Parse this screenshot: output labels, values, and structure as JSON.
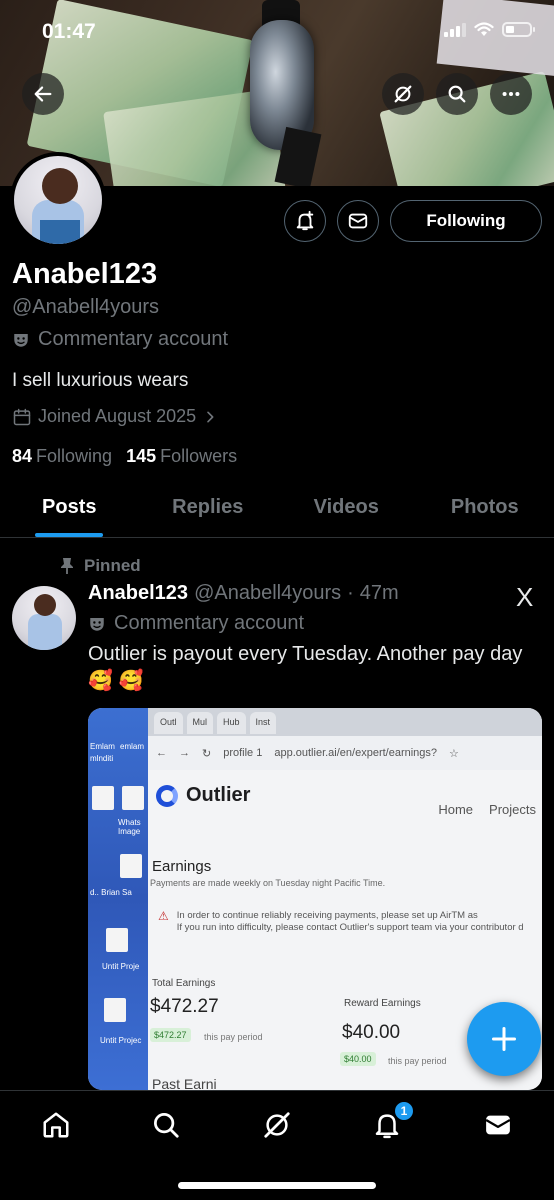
{
  "status_bar": {
    "time": "01:47"
  },
  "profile": {
    "display_name": "Anabel123",
    "handle": "@Anabell4yours",
    "account_label": "Commentary account",
    "bio": "I sell luxurious wears",
    "joined": "Joined August 2025",
    "following_count": "84",
    "following_label": "Following",
    "followers_count": "145",
    "followers_label": "Followers",
    "follow_button_label": "Following"
  },
  "tabs": [
    "Posts",
    "Replies",
    "Videos",
    "Photos"
  ],
  "active_tab": "Posts",
  "post": {
    "pinned_label": "Pinned",
    "author_name": "Anabel123",
    "author_handle": "@Anabell4yours",
    "separator": "·",
    "time_ago": "47m",
    "account_label": "Commentary account",
    "text": "Outlier is payout every Tuesday. Another pay day🥰 🥰",
    "media": {
      "browser_tabs": [
        "Outl",
        "Mul",
        "Hub",
        "Inst"
      ],
      "address_profile": "profile 1",
      "address_url": "app.outlier.ai/en/expert/earnings?",
      "brand": "Outlier",
      "nav_home": "Home",
      "nav_projects": "Projects",
      "earnings_title": "Earnings",
      "earnings_subtitle": "Payments are made weekly on Tuesday night Pacific Time.",
      "warning_line1": "In order to continue reliably receiving payments, please set up AirTM as",
      "warning_line2": "If you run into difficulty, please contact Outlier's support team via your contributor d",
      "total_label": "Total Earnings",
      "total_value": "$472.27",
      "total_chip": "$472.27",
      "total_period": "this pay period",
      "reward_label": "Reward Earnings",
      "reward_value": "$40.00",
      "reward_chip": "$40.00",
      "reward_period": "this pay period",
      "past_label": "Past Earni",
      "desktop_labels": [
        "Whats Image",
        "d.. Brian Sa",
        "Untit Proje",
        "Untit Projec"
      ],
      "desktop_top": [
        "Emlam",
        "emlam",
        "mlnditi"
      ]
    }
  },
  "notifications_badge": "1",
  "x_logo": "X",
  "colors": {
    "accent": "#1d9bf0",
    "muted": "#71767b",
    "border": "#2f3336"
  }
}
